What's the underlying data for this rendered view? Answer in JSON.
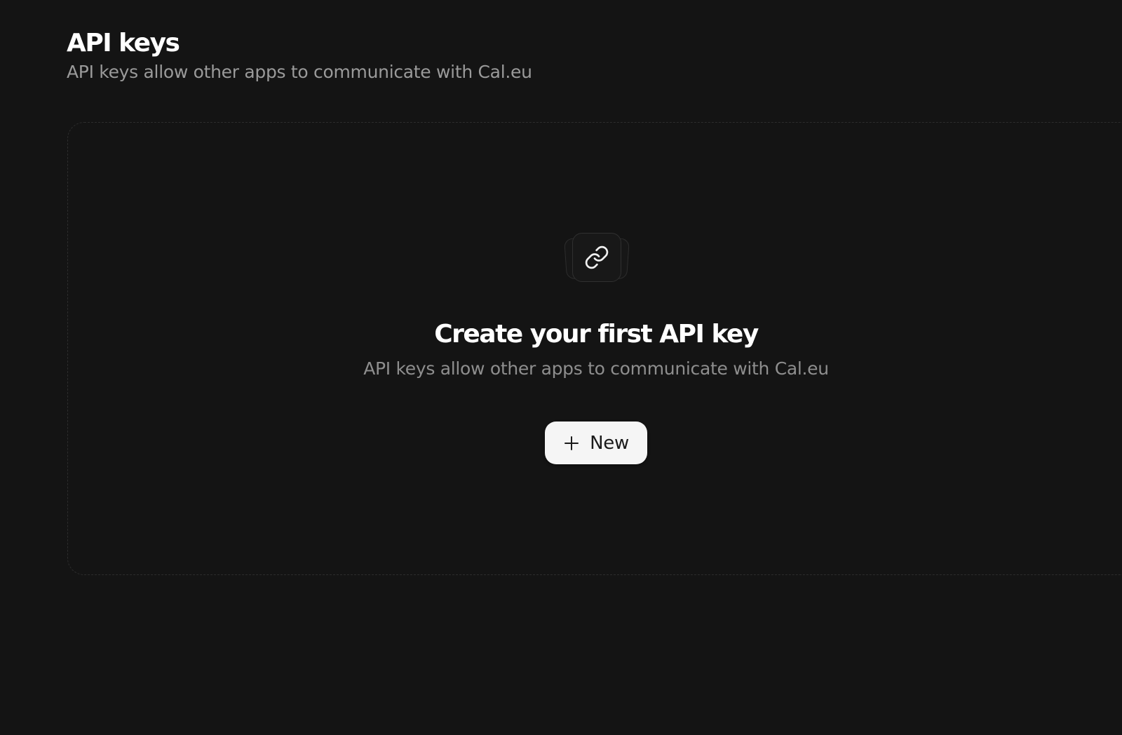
{
  "header": {
    "title": "API keys",
    "subtitle": "API keys allow other apps to communicate with Cal.eu"
  },
  "empty_state": {
    "icon": "link-icon",
    "title": "Create your first API key",
    "description": "API keys allow other apps to communicate with Cal.eu",
    "new_button_label": "New",
    "new_button_icon": "plus-icon"
  },
  "colors": {
    "background": "#141414",
    "title": "#ffffff",
    "muted_text": "#9a9a9a",
    "button_bg": "#f5f5f5",
    "button_text": "#1b1b1b"
  }
}
